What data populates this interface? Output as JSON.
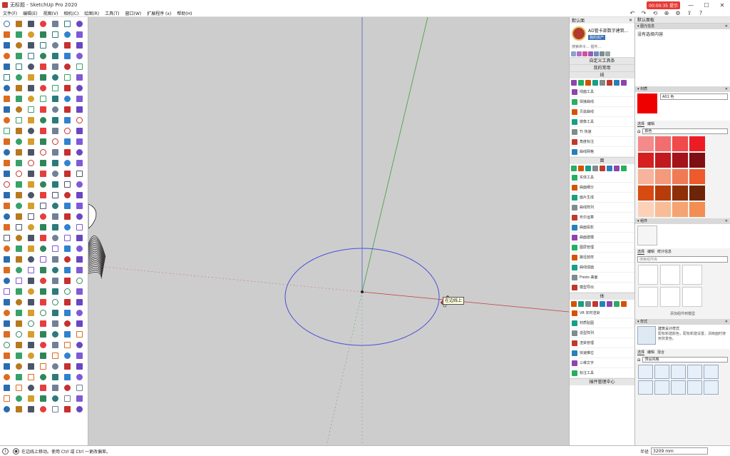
{
  "window": {
    "title": "无标题 - SketchUp Pro 2020",
    "recording_badge": "00:00:35 提示",
    "controls": [
      "—",
      "☐",
      "✕"
    ]
  },
  "menubar": {
    "items": [
      "文件(F)",
      "编辑(E)",
      "视图(V)",
      "相机(C)",
      "绘图(R)",
      "工具(T)",
      "窗口(W)",
      "扩展程序 (x)",
      "帮助(H)"
    ]
  },
  "viewport": {
    "tooltip": "在边线上",
    "axis_colors": {
      "blue": "#4a5fc9",
      "green": "#3f9e3f",
      "red": "#c63b3b"
    },
    "circle_color": "#4b50d8"
  },
  "plugin_panel": {
    "header": "默认面",
    "profile": {
      "name": "AD管卡部数字建筑...",
      "button": "我的资产"
    },
    "search_placeholder": "搜索命令... 插件...",
    "sections": [
      {
        "title": "自定义工具条",
        "items": []
      },
      {
        "title": "我的常用",
        "items": []
      },
      {
        "title": "线",
        "items": [
          "线面工具",
          "焊接曲线",
          "贝兹曲线",
          "镜像工具",
          "Tt 快速",
          "角度标注",
          "曲线网格"
        ]
      },
      {
        "title": "面",
        "items": [
          "实体工具",
          "曲面细分",
          "面片生成",
          "曲线阵列",
          "布尔运算",
          "曲面投影",
          "曲面建模",
          "图层管理",
          "路径放样",
          "曲线成面",
          "Fredo 曲面",
          "模型导出"
        ]
      },
      {
        "title": "体",
        "items": [
          "VR 实时渲染",
          "材质贴图",
          "造型阵列",
          "渲染管理",
          "快速推拉",
          "三维文字",
          "标注工具"
        ]
      }
    ],
    "footer": "插件管理中心"
  },
  "default_tray": {
    "title": "默认面板",
    "entity_info": {
      "header": "▾ 图元信息",
      "body": "没有选择内容"
    },
    "materials": {
      "header": "▾ 材质",
      "material_name": "A01 色",
      "tabs": [
        "选择",
        "编辑"
      ],
      "library": "颜色",
      "colors": [
        "#f58a8a",
        "#f26d6d",
        "#f04a4a",
        "#ed1c24",
        "#d61f1f",
        "#c2191e",
        "#a3151a",
        "#7e0f13",
        "#f7b39b",
        "#f4997a",
        "#f07a55",
        "#ee5a2b",
        "#d84b10",
        "#b83c0a",
        "#8e2f08",
        "#6e2406",
        "#fbd2b8",
        "#f8bd97",
        "#f5a372",
        "#f38d51"
      ]
    },
    "components": {
      "header": "▾ 组件",
      "tabs": [
        "选择",
        "编辑",
        "统计信息"
      ],
      "search": "搜索组件库",
      "footer": "添加组件到模型"
    },
    "styles": {
      "header": "▾ 样式",
      "style_name": "建筑设计样式",
      "style_desc": "配有新建颜色，配有新建设置，清晰面时使用背景色。",
      "tabs": [
        "选择",
        "编辑",
        "混合"
      ],
      "library": "预设风格"
    }
  },
  "statusbar": {
    "hint": "在边线上移动。使用 Ctrl 或 Ctrl 一更改偏差。",
    "measure_label": "半径",
    "measure_value": "3209 mm"
  }
}
